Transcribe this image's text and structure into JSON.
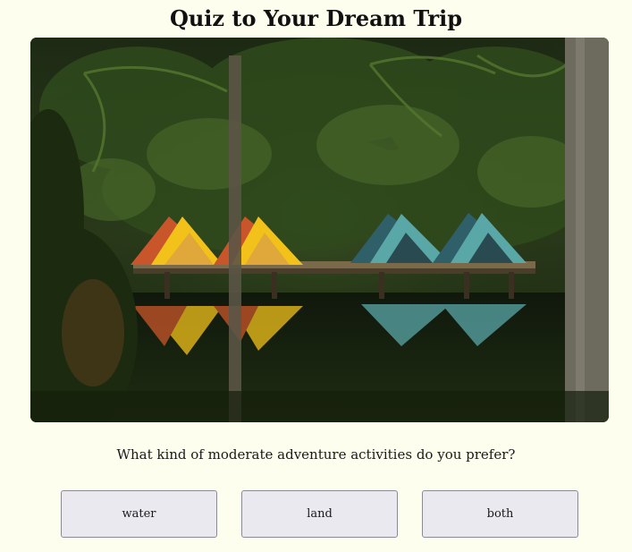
{
  "quiz": {
    "title": "Quiz to Your Dream Trip",
    "question": "What kind of moderate adventure activities do you prefer?",
    "choices": [
      {
        "label": "water"
      },
      {
        "label": "land"
      },
      {
        "label": "both"
      }
    ]
  },
  "image": {
    "subject": "tents on wooden dock reflected in jungle lake",
    "tent_colors": [
      "#f2c21b",
      "#c8562a",
      "#5aa7a8",
      "#2f5f68"
    ]
  },
  "colors": {
    "background": "#fefeee",
    "button_background": "#e9e9ef",
    "button_border": "#8a8a92"
  }
}
